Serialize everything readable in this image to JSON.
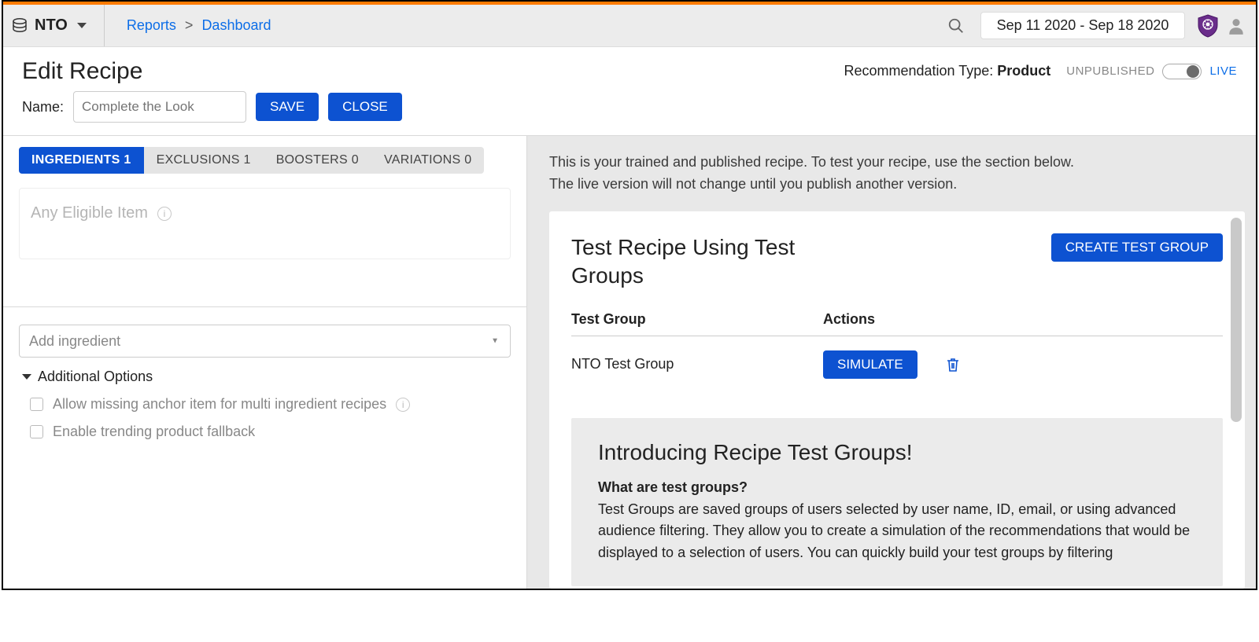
{
  "topbar": {
    "org": "NTO",
    "breadcrumb": {
      "reports": "Reports",
      "dashboard": "Dashboard",
      "sep": ">"
    },
    "dateRange": "Sep 11 2020 - Sep 18 2020"
  },
  "header": {
    "title": "Edit Recipe",
    "recType": {
      "label": "Recommendation Type: ",
      "value": "Product"
    },
    "publish": {
      "unpublished": "UNPUBLISHED",
      "live": "LIVE"
    }
  },
  "form": {
    "nameLabel": "Name:",
    "namePlaceholder": "Complete the Look",
    "save": "SAVE",
    "close": "CLOSE"
  },
  "tabs": {
    "ingredients": "INGREDIENTS 1",
    "exclusions": "EXCLUSIONS 1",
    "boosters": "BOOSTERS 0",
    "variations": "VARIATIONS 0"
  },
  "eligible": {
    "title": "Any Eligible Item"
  },
  "addIngredient": {
    "placeholder": "Add ingredient"
  },
  "options": {
    "heading": "Additional Options",
    "allowMissing": "Allow missing anchor item for multi ingredient recipes",
    "enableFallback": "Enable trending product fallback"
  },
  "right": {
    "instruction": "This is your trained and published recipe. To test your recipe, use the section below. The live version will not change until you publish another version.",
    "testTitle": "Test Recipe Using Test Groups",
    "createTestGroup": "CREATE TEST GROUP",
    "colA": "Test Group",
    "colB": "Actions",
    "rowName": "NTO Test Group",
    "simulate": "SIMULATE",
    "intro": {
      "title": "Introducing Recipe Test Groups!",
      "sub": "What are test groups?",
      "body": "Test Groups are saved groups of users selected by user name, ID, email, or using advanced audience filtering. They allow you to create a simulation of the recommendations that would be displayed to a selection of users. You can quickly build your test groups by filtering"
    }
  }
}
